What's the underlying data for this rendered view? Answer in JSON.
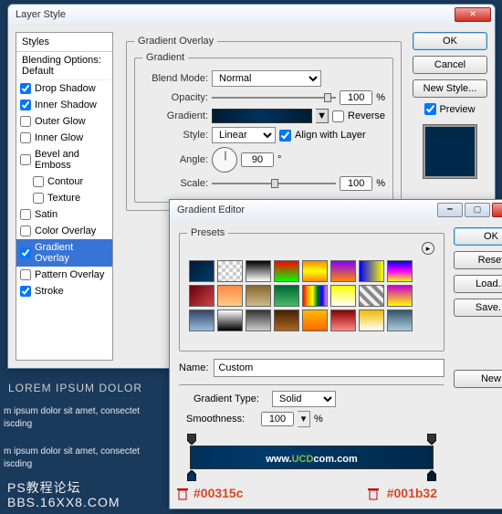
{
  "bg": {
    "line1": "LOREM IPSUM DOLOR",
    "line2": "m ipsum dolor sit amet, consectet\niscding",
    "line3": "m ipsum dolor sit amet, consectet\niscding",
    "footer1": "PS教程论坛",
    "footer2": "BBS.16XX8.COM"
  },
  "layerStyle": {
    "title": "Layer Style",
    "stylesHeader": "Styles",
    "blendingOptions": "Blending Options: Default",
    "items": [
      {
        "label": "Drop Shadow",
        "checked": true
      },
      {
        "label": "Inner Shadow",
        "checked": true
      },
      {
        "label": "Outer Glow",
        "checked": false
      },
      {
        "label": "Inner Glow",
        "checked": false
      },
      {
        "label": "Bevel and Emboss",
        "checked": false
      },
      {
        "label": "Contour",
        "checked": false,
        "indent": true
      },
      {
        "label": "Texture",
        "checked": false,
        "indent": true
      },
      {
        "label": "Satin",
        "checked": false
      },
      {
        "label": "Color Overlay",
        "checked": false
      },
      {
        "label": "Gradient Overlay",
        "checked": true,
        "selected": true
      },
      {
        "label": "Pattern Overlay",
        "checked": false
      },
      {
        "label": "Stroke",
        "checked": true
      }
    ],
    "groupTitle": "Gradient Overlay",
    "subGroup": "Gradient",
    "blendModeLabel": "Blend Mode:",
    "blendModeValue": "Normal",
    "opacityLabel": "Opacity:",
    "opacityValue": "100",
    "pct": "%",
    "gradientLabel": "Gradient:",
    "reverseLabel": "Reverse",
    "styleLabel": "Style:",
    "styleValue": "Linear",
    "alignLabel": "Align with Layer",
    "angleLabel": "Angle:",
    "angleValue": "90",
    "deg": "°",
    "scaleLabel": "Scale:",
    "scaleValue": "100",
    "okBtn": "OK",
    "cancelBtn": "Cancel",
    "newStyleBtn": "New Style...",
    "previewLabel": "Preview"
  },
  "gradEditor": {
    "title": "Gradient Editor",
    "presetsLabel": "Presets",
    "presets": [
      "linear-gradient(135deg,#001b32,#003a6b)",
      "repeating-conic-gradient(#ccc 0 25%,#fff 0 50%) 0 0/8px 8px",
      "linear-gradient(#000,#fff)",
      "linear-gradient(#f00,#0f0)",
      "linear-gradient(#f80,#ff0,#f80)",
      "linear-gradient(#80f,#f80)",
      "linear-gradient(90deg,#00f,#ff0)",
      "linear-gradient(#00f,#f0f,#ff0)",
      "linear-gradient(135deg,#601,#c44)",
      "linear-gradient(#f84,#fc8)",
      "linear-gradient(#863,#cb8)",
      "linear-gradient(#063,#4b6)",
      "linear-gradient(90deg,red,orange,yellow,green,blue,violet)",
      "linear-gradient(#ff0,#fff)",
      "repeating-linear-gradient(45deg,#888 0 4px,#eee 0 8px)",
      "linear-gradient(#c0c,#ff0)",
      "linear-gradient(#346,#9bd)",
      "linear-gradient(#fff,#000)",
      "linear-gradient(#333,#ccc)",
      "linear-gradient(#420,#a62)",
      "linear-gradient(#fb0,#f60)",
      "linear-gradient(#800,#f88)",
      "linear-gradient(#eb0,#fff)",
      "linear-gradient(#356,#acd)"
    ],
    "nameLabel": "Name:",
    "nameValue": "Custom",
    "newBtn": "New",
    "typeLabel": "Gradient Type:",
    "typeValue": "Solid",
    "smoothLabel": "Smoothness:",
    "smoothValue": "100",
    "pct": "%",
    "okBtn": "OK",
    "resetBtn": "Reset",
    "loadBtn": "Load...",
    "saveBtn": "Save...",
    "barText1": "www.",
    "barText2": "UCD",
    "barText3": "com",
    "barText4": ".com",
    "colorStop1": "#00315c",
    "colorStop2": "#001b32"
  }
}
